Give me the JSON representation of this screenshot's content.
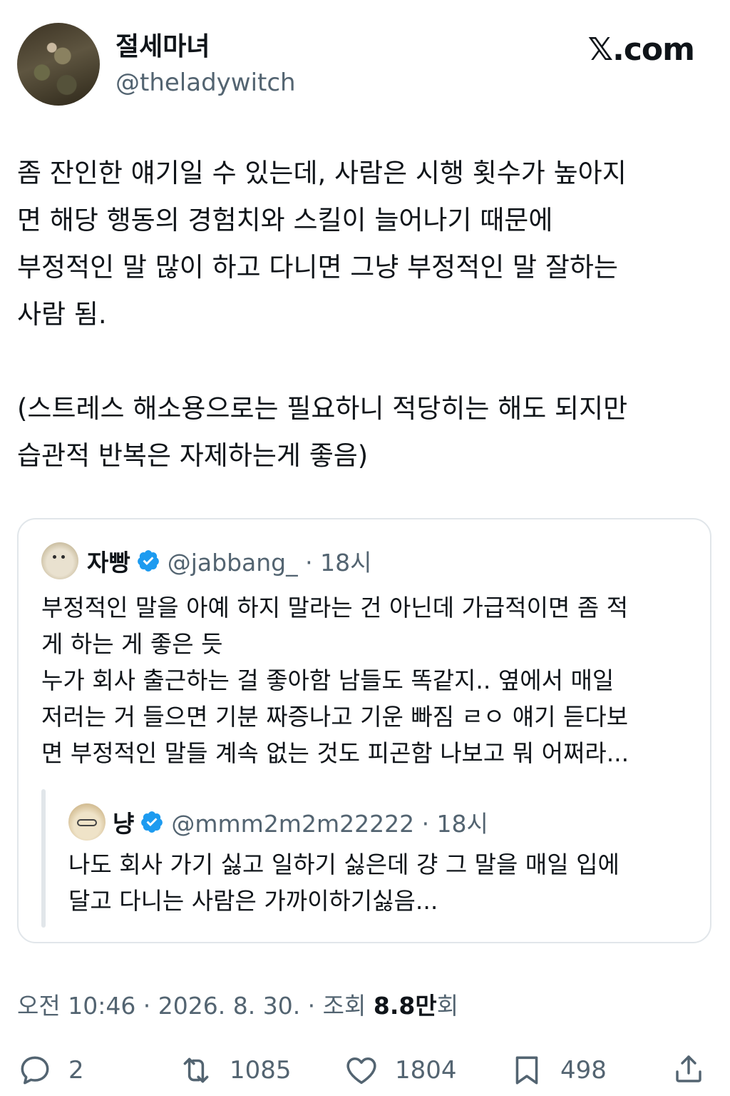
{
  "author": {
    "display_name": "절세마녀",
    "handle": "@theladywitch"
  },
  "brand": "𝕏.com",
  "tweet": {
    "text": "좀 잔인한 얘기일 수 있는데, 사람은 시행 횟수가 높아지\n면 해당 행동의 경험치와 스킬이 늘어나기 때문에\n부정적인 말 많이 하고 다니면 그냥 부정적인 말 잘하는\n사람 됨.\n\n(스트레스 해소용으로는 필요하니 적당히는 해도 되지만\n습관적 반복은 자제하는게 좋음)"
  },
  "quote": {
    "display_name": "자빵",
    "handle_time": "@jabbang_ · 18시",
    "text": "부정적인 말을 아예 하지 말라는 건 아닌데 가급적이면 좀 적\n게 하는 게 좋은 듯\n누가 회사 출근하는 걸 좋아함 남들도 똑같지.. 옆에서 매일\n저러는 거 들으면 기분 짜증나고 기운 빠짐 ㄹㅇ 얘기 듣다보\n면 부정적인 말들 계속 없는 것도 피곤함 나보고 뭐 어쩌라...",
    "nested": {
      "display_name": "냥",
      "handle_time": "@mmm2m2m22222 · 18시",
      "text": "나도 회사 가기 싫고 일하기 싫은데 걍 그 말을 매일 입에\n달고 다니는 사람은 가까이하기싫음..."
    }
  },
  "meta": {
    "time_date": "오전 10:46 · 2026. 8. 30. · 조회 ",
    "views": "8.8만",
    "views_suffix": "회"
  },
  "actions": {
    "replies": "2",
    "reposts": "1085",
    "likes": "1804",
    "bookmarks": "498"
  },
  "colors": {
    "text": "#0f1419",
    "secondary": "#536471",
    "verified": "#1d9bf0",
    "border": "#e1e6ea"
  }
}
